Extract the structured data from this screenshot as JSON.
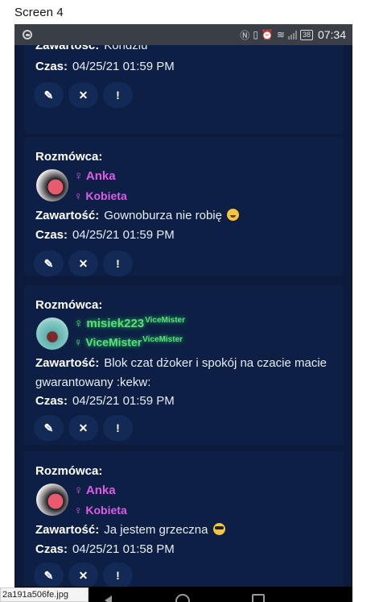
{
  "screen_label": "Screen 4",
  "status_bar": {
    "time": "07:34",
    "battery": "38",
    "icons": [
      "messenger-icon",
      "nfc-icon",
      "vibrate-icon",
      "alarm-icon",
      "wifi-icon",
      "signal-icon",
      "battery-icon"
    ]
  },
  "labels": {
    "interlocutor": "Rozmówca:",
    "content": "Zawartość:",
    "time": "Czas:"
  },
  "partial_top": {
    "content": "Kondziu",
    "time": "04/25/21 01:59 PM"
  },
  "actions": {
    "edit_icon": "✎",
    "delete_icon": "✕",
    "report_icon": "!"
  },
  "messages": [
    {
      "user": "Anka",
      "role": "Kobieta",
      "content": "Gownoburza nie robię",
      "emoji": "laughing-emoji",
      "time": "04/25/21 01:59 PM"
    },
    {
      "user": "misiek223",
      "user_badge": "ViceMister",
      "role": "ViceMister",
      "role_badge": "ViceMister",
      "content": "Blok czat dżoker i spokój na czacie macie gwarantowany :kekw:",
      "time": "04/25/21 01:59 PM"
    },
    {
      "user": "Anka",
      "role": "Kobieta",
      "content": "Ja jestem grzeczna",
      "emoji": "cool-emoji",
      "time": "04/25/21 01:58 PM"
    }
  ],
  "filename_tab": "2a191a506fe.jpg",
  "colors": {
    "background": "#0c1a3b",
    "card": "#0d1f45",
    "female_accent": "#e05be6",
    "vicemister_accent": "#57e07a"
  }
}
